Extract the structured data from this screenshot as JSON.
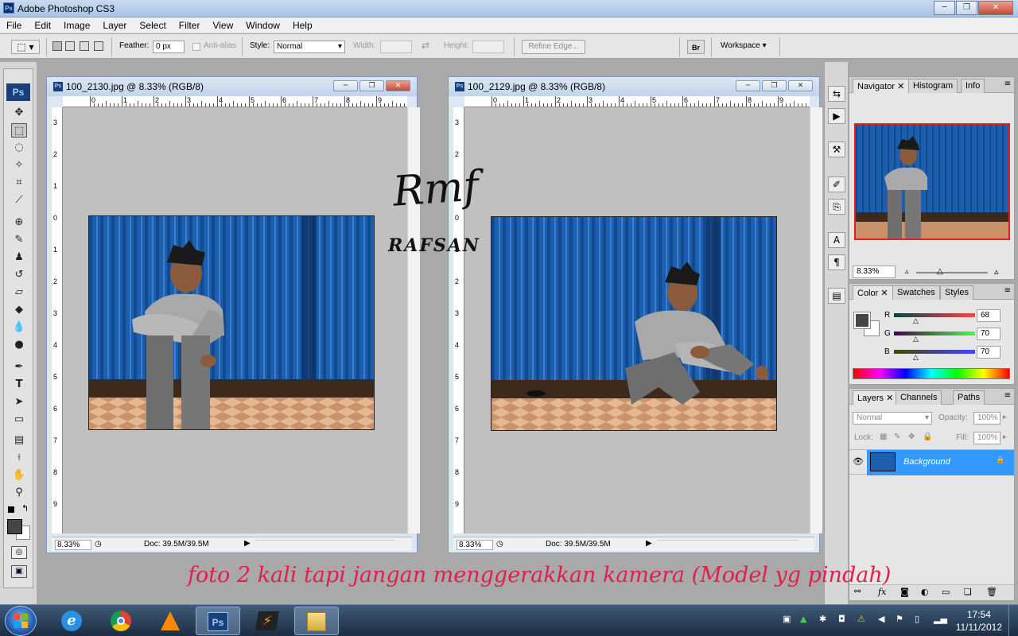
{
  "window": {
    "title": "Adobe Photoshop CS3",
    "minimize": "─",
    "maximize": "❐",
    "close": "✕"
  },
  "menu": [
    "File",
    "Edit",
    "Image",
    "Layer",
    "Select",
    "Filter",
    "View",
    "Window",
    "Help"
  ],
  "options": {
    "feather_label": "Feather:",
    "feather_value": "0 px",
    "antialias_label": "Anti-alias",
    "style_label": "Style:",
    "style_value": "Normal",
    "width_label": "Width:",
    "height_label": "Height:",
    "refine_edge": "Refine Edge...",
    "workspace": "Workspace"
  },
  "documents": [
    {
      "title": "100_2130.jpg @ 8.33% (RGB/8)",
      "zoom": "8.33%",
      "doc_info": "Doc: 39.5M/39.5M"
    },
    {
      "title": "100_2129.jpg @ 8.33% (RGB/8)",
      "zoom": "8.33%",
      "doc_info": "Doc: 39.5M/39.5M"
    }
  ],
  "ruler": {
    "h_labels": [
      "0",
      "1",
      "2",
      "3",
      "4",
      "5",
      "6",
      "7",
      "8",
      "9"
    ],
    "v_labels": [
      "3",
      "2",
      "1",
      "0",
      "1",
      "2",
      "3",
      "4",
      "5",
      "6",
      "7",
      "8",
      "9"
    ]
  },
  "signature": {
    "mark": "Rmf",
    "name": "RAFSAN"
  },
  "panels": {
    "navigator": {
      "tabs": [
        "Navigator",
        "Histogram",
        "Info"
      ],
      "zoom": "8.33%"
    },
    "color": {
      "tabs": [
        "Color",
        "Swatches",
        "Styles"
      ],
      "r_label": "R",
      "g_label": "G",
      "b_label": "B",
      "r_value": "68",
      "g_value": "70",
      "b_value": "70",
      "foreground": "#444646",
      "r": 68,
      "g": 70,
      "b": 70
    },
    "layers": {
      "tabs": [
        "Layers",
        "Channels",
        "Paths"
      ],
      "blend_mode": "Normal",
      "opacity_label": "Opacity:",
      "opacity_value": "100%",
      "lock_label": "Lock:",
      "fill_label": "Fill:",
      "fill_value": "100%",
      "layer_name": "Background"
    }
  },
  "caption": "foto 2 kali tapi jangan menggerakkan kamera (Model yg pindah)",
  "taskbar": {
    "time": "17:54",
    "date": "11/11/2012"
  },
  "colors": {
    "accent": "#3399ff",
    "caption": "#e0204a",
    "wall_blue": "#1d5fae"
  }
}
